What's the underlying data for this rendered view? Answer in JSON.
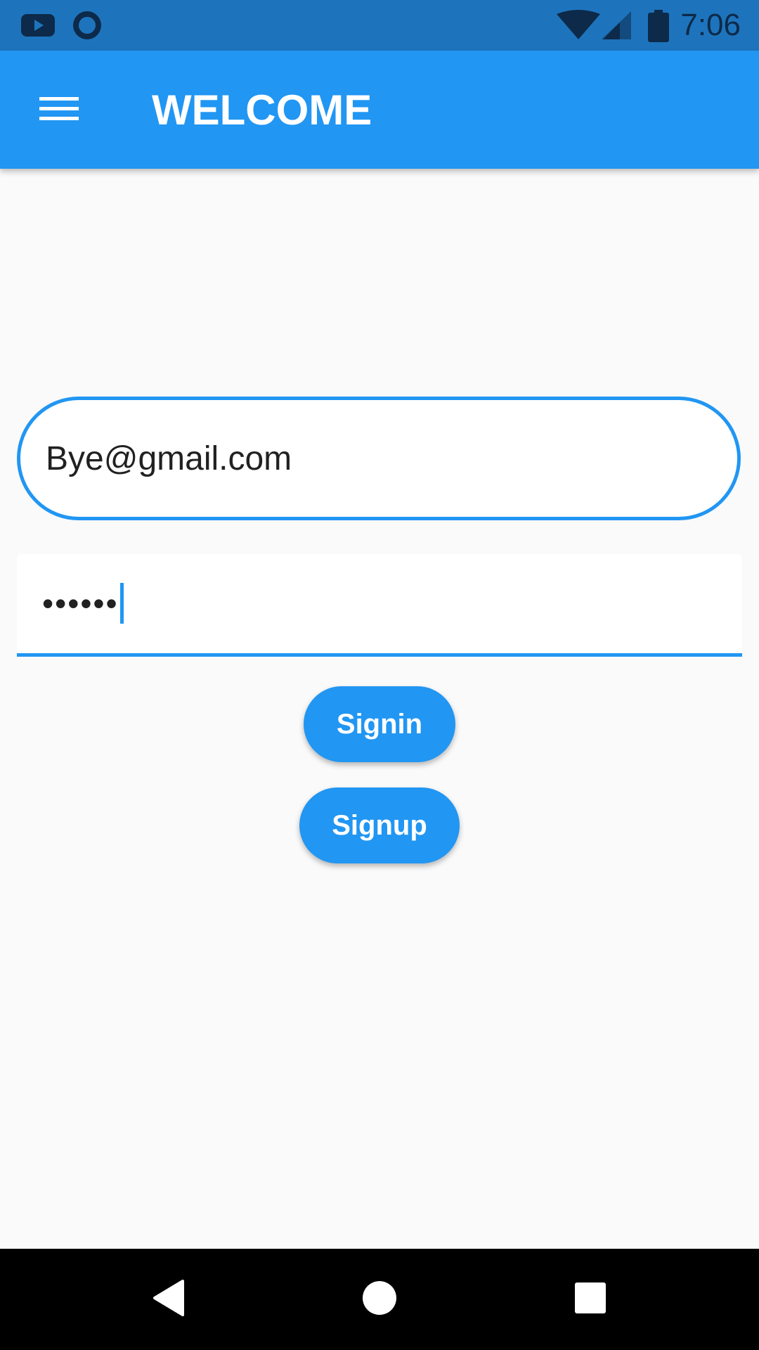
{
  "status_bar": {
    "time": "7:06",
    "left_icons": [
      "youtube-icon",
      "circle-notification-icon"
    ],
    "right_icons": [
      "wifi-icon",
      "cell-signal-icon",
      "battery-icon"
    ]
  },
  "app_bar": {
    "title": "WELCOME",
    "menu_icon": "hamburger-menu-icon"
  },
  "form": {
    "email_value": "Bye@gmail.com",
    "password_value": "••••••",
    "signin_label": "Signin",
    "signup_label": "Signup"
  },
  "nav_bar": {
    "icons": [
      "back-icon",
      "home-icon",
      "recents-icon"
    ]
  },
  "colors": {
    "primary": "#2196f3",
    "status_bar": "#1e74bc",
    "background": "#fafafa"
  }
}
